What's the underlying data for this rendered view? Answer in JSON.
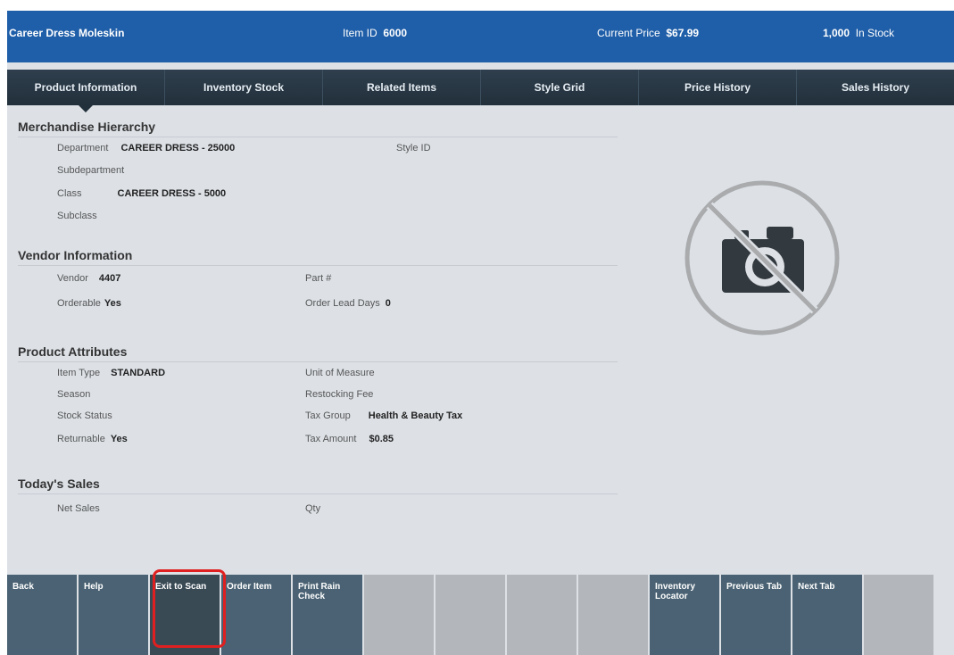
{
  "header": {
    "item_name": "Career Dress Moleskin",
    "item_id_label": "Item ID",
    "item_id": "6000",
    "price_label": "Current Price",
    "price": "$67.99",
    "stock": "1,000",
    "stock_label": "In Stock"
  },
  "tabs": [
    "Product Information",
    "Inventory Stock",
    "Related Items",
    "Style Grid",
    "Price History",
    "Sales History"
  ],
  "sections": {
    "hierarchy": {
      "title": "Merchandise Hierarchy",
      "department_label": "Department",
      "department": "CAREER DRESS - 25000",
      "style_label": "Style ID",
      "subdepartment_label": "Subdepartment",
      "class_label": "Class",
      "class": "CAREER DRESS - 5000",
      "subclass_label": "Subclass"
    },
    "vendor": {
      "title": "Vendor Information",
      "vendor_label": "Vendor",
      "vendor": "4407",
      "part_label": "Part #",
      "orderable_label": "Orderable",
      "orderable": "Yes",
      "lead_label": "Order Lead Days",
      "lead": "0"
    },
    "attributes": {
      "title": "Product Attributes",
      "type_label": "Item Type",
      "type": "STANDARD",
      "uom_label": "Unit of Measure",
      "season_label": "Season",
      "restock_label": "Restocking Fee",
      "status_label": "Stock Status",
      "taxgroup_label": "Tax Group",
      "taxgroup": "Health & Beauty Tax",
      "returnable_label": "Returnable",
      "returnable": "Yes",
      "taxamount_label": "Tax Amount",
      "taxamount": "$0.85"
    },
    "sales": {
      "title": "Today's Sales",
      "net_label": "Net Sales",
      "qty_label": "Qty"
    }
  },
  "footer": {
    "b1": "Back",
    "b2": "Help",
    "b3": "Exit to Scan",
    "b4": "Order Item",
    "b5": "Print Rain Check",
    "b10": "Inventory Locator",
    "b11": "Previous Tab",
    "b12": "Next Tab"
  },
  "icons": {
    "photo": "no-photo-icon"
  },
  "colors": {
    "header": "#1f5ea8",
    "highlight": "#e02020"
  }
}
